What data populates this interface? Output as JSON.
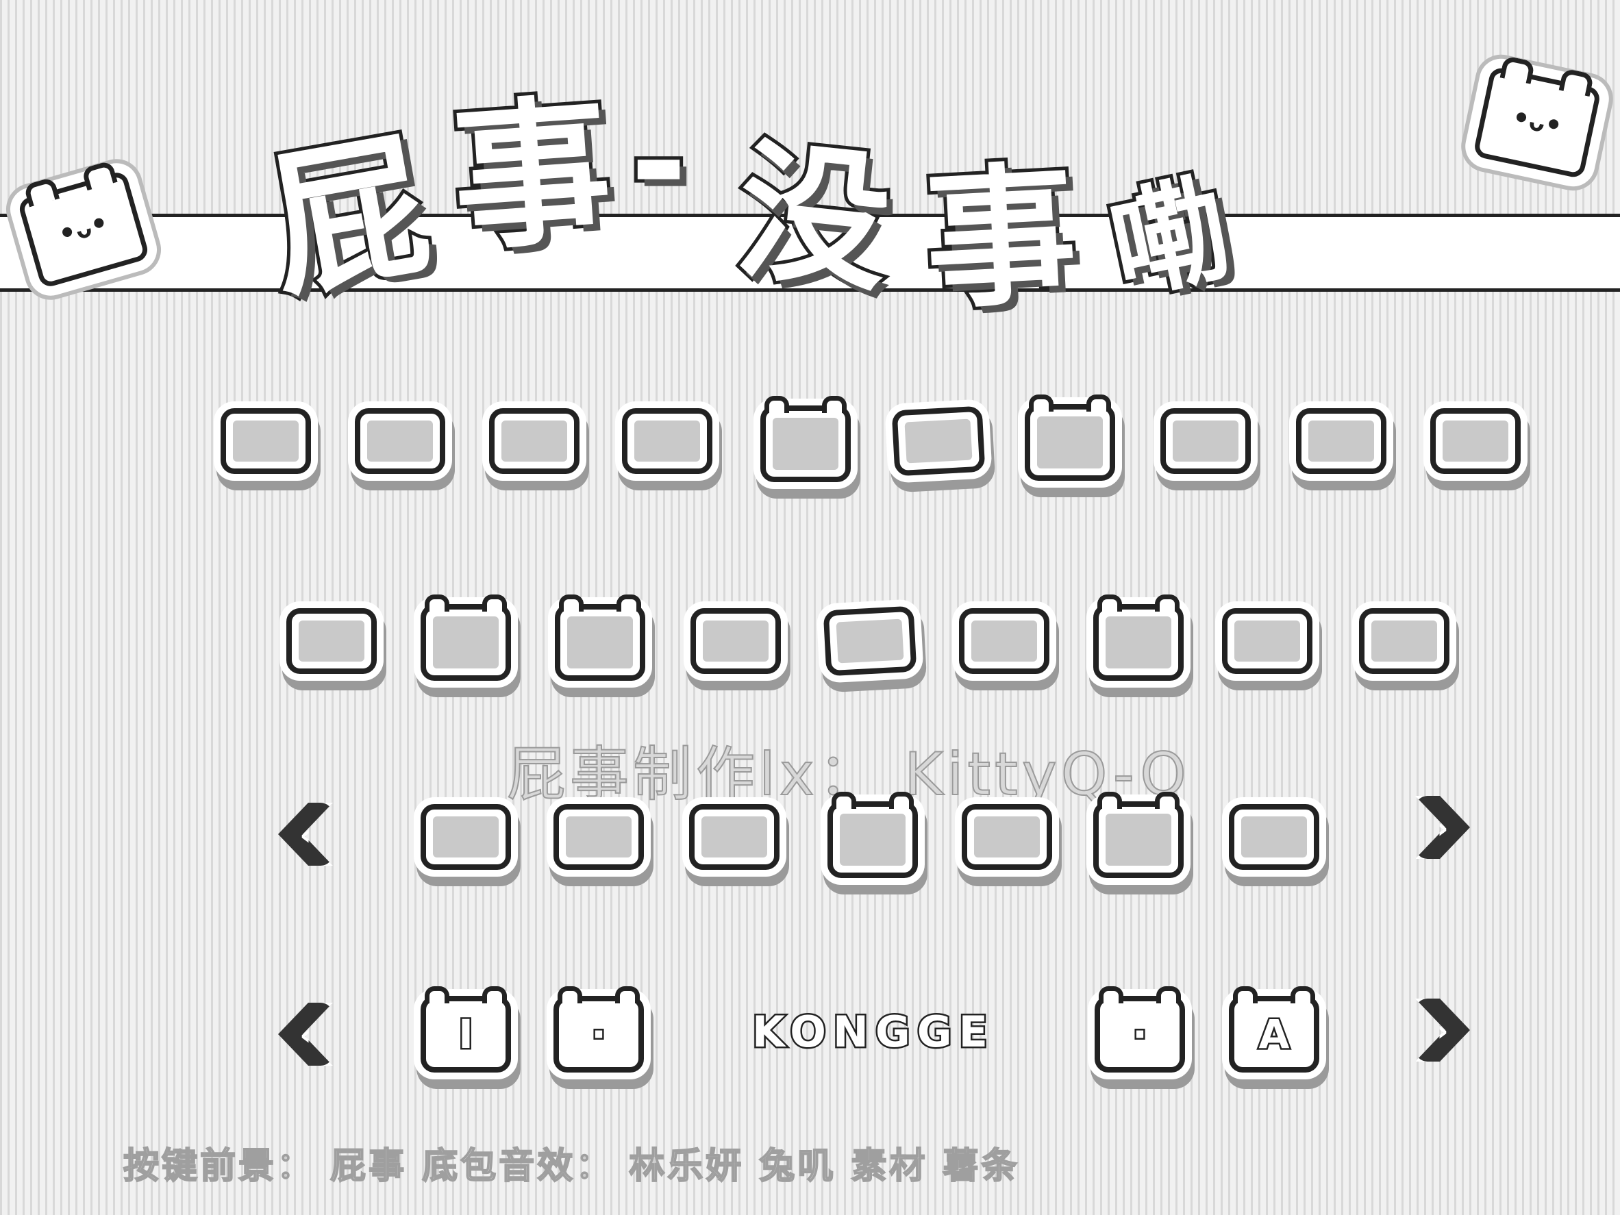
{
  "header": {
    "title_chars": [
      "屁",
      "事",
      "-",
      "没",
      "事",
      "嘞"
    ]
  },
  "keyboard": {
    "row1_count": 10,
    "row2_count": 9,
    "row3_count": 7,
    "bottom_row": {
      "key_1": "I",
      "key_2": "·",
      "space": "KONGGE",
      "key_4": "·",
      "key_5": "A"
    }
  },
  "credit": "屁事制作lx： KittyQ-O",
  "footer": {
    "text": "按键前景：  屁事  底包音效：  林乐妍  兔叽  素材  薯条"
  },
  "icons": {
    "mascot": "bear-face-icon",
    "nav_prev": "chevron-left-icon",
    "nav_next": "chevron-right-icon"
  },
  "colors": {
    "outline": "#222222",
    "key_fill": "#c9c9c9",
    "background": "#f1f1f1"
  }
}
